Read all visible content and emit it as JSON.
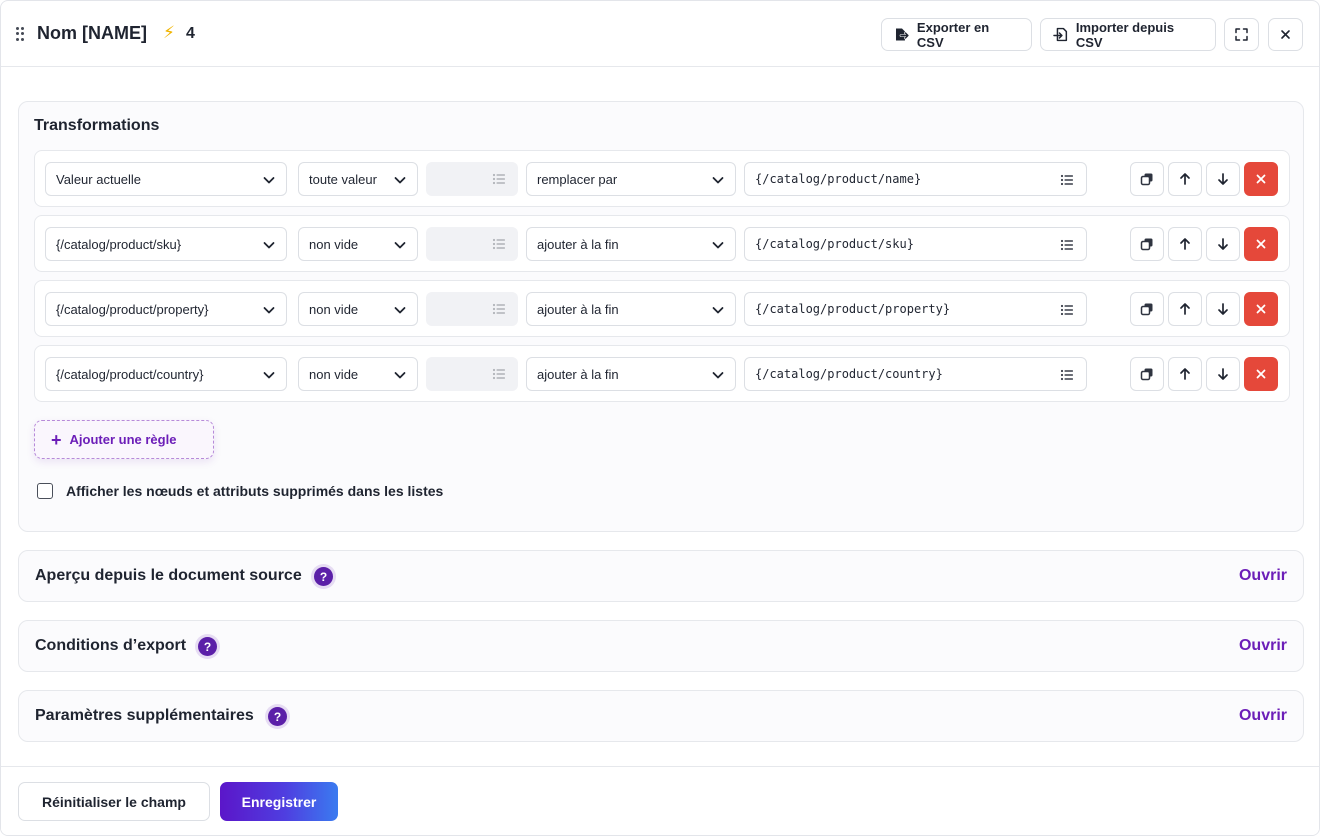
{
  "header": {
    "title": "Nom [NAME]",
    "bolt_icon": "⚡",
    "bolt_count": "4",
    "export_label": "Exporter en CSV",
    "import_label": "Importer depuis CSV"
  },
  "transformations": {
    "title": "Transformations",
    "rules": [
      {
        "source": "Valeur actuelle",
        "condition": "toute valeur",
        "action": "remplacer par",
        "value": "{/catalog/product/name}"
      },
      {
        "source": "{/catalog/product/sku}",
        "condition": "non vide",
        "action": "ajouter à la fin",
        "value": "{/catalog/product/sku}"
      },
      {
        "source": "{/catalog/product/property}",
        "condition": "non vide",
        "action": "ajouter à la fin",
        "value": "{/catalog/product/property}"
      },
      {
        "source": "{/catalog/product/country}",
        "condition": "non vide",
        "action": "ajouter à la fin",
        "value": "{/catalog/product/country}"
      }
    ],
    "add_rule_label": "Ajouter une règle",
    "show_deleted_label": "Afficher les nœuds et attributs supprimés dans les listes",
    "show_deleted_checked": false
  },
  "sections": [
    {
      "title": "Aperçu depuis le document source",
      "help": "?",
      "open_label": "Ouvrir"
    },
    {
      "title": "Conditions d’export",
      "help": "?",
      "open_label": "Ouvrir"
    },
    {
      "title": "Paramètres supplémentaires",
      "help": "?",
      "open_label": "Ouvrir"
    }
  ],
  "footer": {
    "reset_label": "Réinitialiser le champ",
    "save_label": "Enregistrer"
  },
  "colors": {
    "accent": "#6c1eb8",
    "delete": "#e5483a",
    "help_badge": "#5b1fa8"
  }
}
